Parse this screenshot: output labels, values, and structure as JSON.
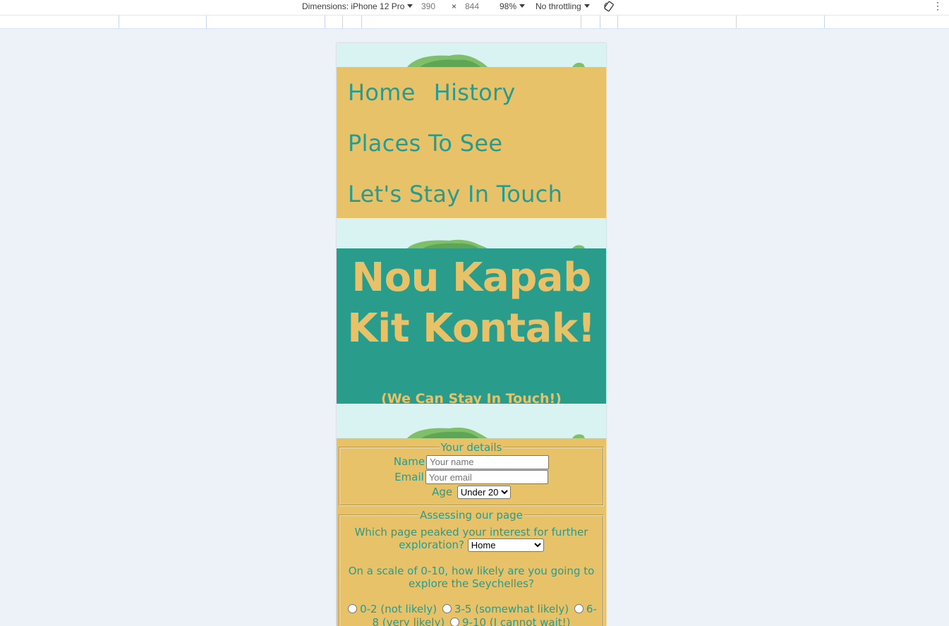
{
  "devtools": {
    "dimensions_label": "Dimensions: iPhone 12 Pro",
    "width": "390",
    "times": "×",
    "height": "844",
    "zoom": "98%",
    "throttling": "No throttling",
    "rotate_icon": "rotate-icon",
    "more_icon": "more-vertical-icon"
  },
  "nav": {
    "items": [
      "Home",
      "History",
      "Places To See",
      "Let's Stay In Touch"
    ]
  },
  "hero": {
    "title_line1": "Nou Kapab",
    "title_line2": "Kit Kontak!",
    "subtitle": "(We Can Stay In Touch!)"
  },
  "details": {
    "legend": "Your details",
    "name_label": "Name",
    "name_placeholder": "Your name",
    "email_label": "Email",
    "email_placeholder": "Your email",
    "age_label": "Age",
    "age_selected": "Under 20"
  },
  "assess": {
    "legend": "Assessing our page",
    "q1": "Which page peaked your interest for further exploration?",
    "q1_selected": "Home",
    "q2": "On a scale of 0-10, how likely are you going to explore the Seychelles?",
    "options": [
      "0-2 (not likely)",
      "3-5 (somewhat likely)",
      "6-8 (very likely)",
      "9-10 (I cannot wait!)"
    ]
  },
  "colors": {
    "gold": "#e8c268",
    "teal": "#2a9c8c",
    "sky": "#d8f3f2"
  }
}
